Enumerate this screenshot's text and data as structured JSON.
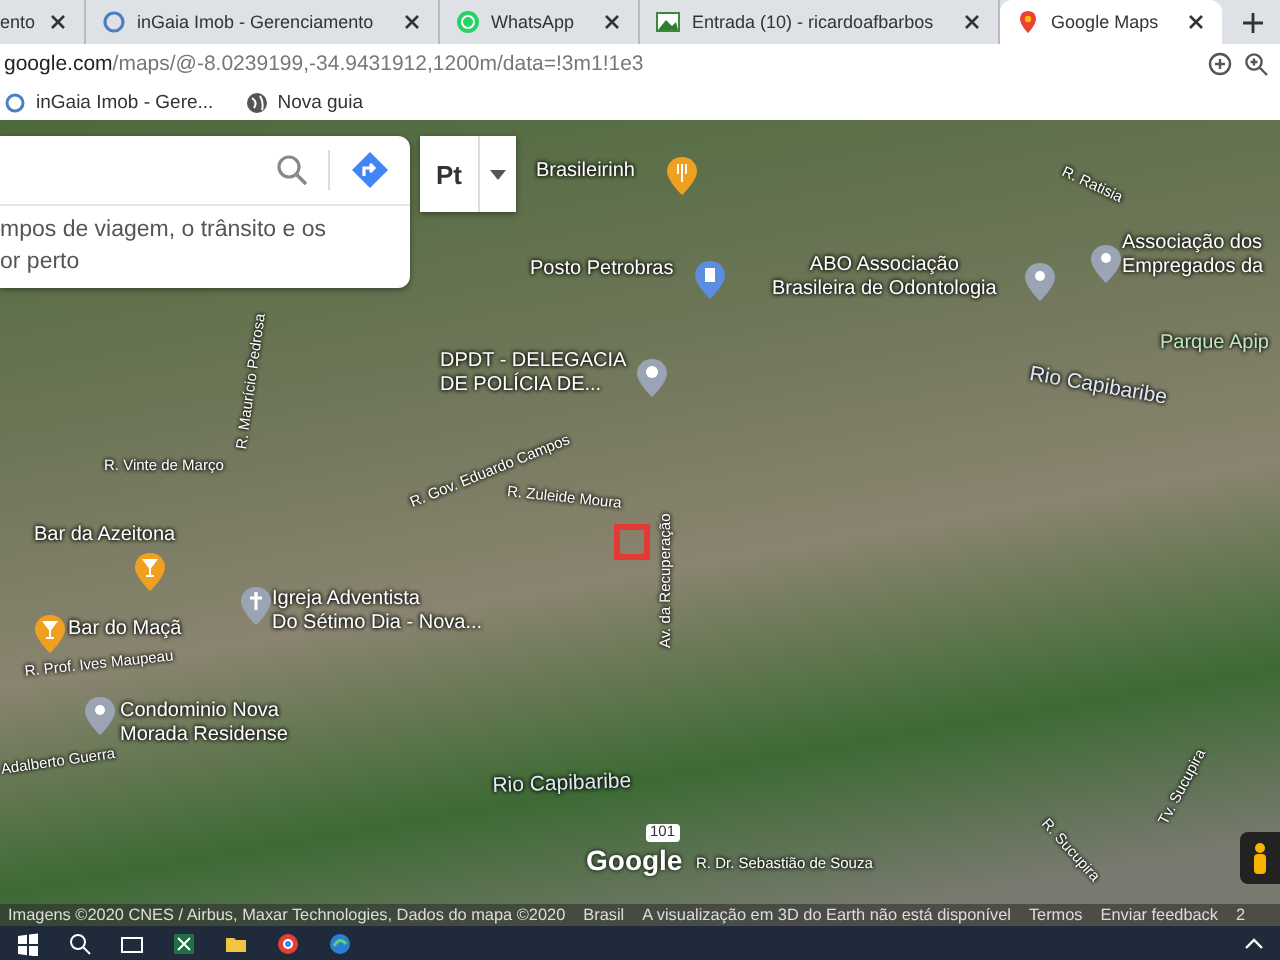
{
  "browser": {
    "tabs": [
      {
        "title": "ento",
        "selected": false
      },
      {
        "title": "inGaia Imob - Gerenciamento",
        "selected": false
      },
      {
        "title": "WhatsApp",
        "selected": false
      },
      {
        "title": "Entrada (10) - ricardoafbarbos",
        "selected": false
      },
      {
        "title": "Google Maps",
        "selected": true
      }
    ],
    "address": {
      "host": "google.com",
      "path": "/maps/@-8.0239199,-34.9431912,1200m/data=!3m1!1e3"
    },
    "bookmarks": [
      {
        "title": "inGaia Imob - Gere..."
      },
      {
        "title": "Nova guia"
      }
    ]
  },
  "map": {
    "search_box": {
      "hint_lines": [
        "mpos de viagem, o trânsito e os",
        "or perto"
      ]
    },
    "language_button": "Pt",
    "labels": [
      {
        "kind": "place",
        "lines": [
          "Brasileirinh"
        ]
      },
      {
        "kind": "place",
        "lines": [
          "Posto Petrobras"
        ]
      },
      {
        "kind": "place",
        "lines": [
          "ABO Associação",
          "Brasileira de Odontologia"
        ]
      },
      {
        "kind": "place",
        "lines": [
          "Associação dos",
          "Empregados da"
        ]
      },
      {
        "kind": "street",
        "lines": [
          "R. Ratisia"
        ]
      },
      {
        "kind": "place",
        "lines": [
          "DPDT - DELEGACIA",
          "DE POLÍCIA DE..."
        ]
      },
      {
        "kind": "park",
        "lines": [
          "Parque Apip"
        ]
      },
      {
        "kind": "water",
        "lines": [
          "Rio Capibaribe"
        ]
      },
      {
        "kind": "street",
        "lines": [
          "R. Maurício Pedrosa"
        ]
      },
      {
        "kind": "street",
        "lines": [
          "R. Gov. Eduardo Campos"
        ]
      },
      {
        "kind": "street",
        "lines": [
          "R. Vinte de Março"
        ]
      },
      {
        "kind": "street",
        "lines": [
          "R. Zuleide Moura"
        ]
      },
      {
        "kind": "street",
        "lines": [
          "Av. da Recuperação"
        ]
      },
      {
        "kind": "place",
        "lines": [
          "Bar da Azeitona"
        ]
      },
      {
        "kind": "place",
        "lines": [
          "Bar do Maçã"
        ]
      },
      {
        "kind": "place",
        "lines": [
          "Igreja Adventista",
          "Do Sétimo Dia - Nova..."
        ]
      },
      {
        "kind": "street",
        "lines": [
          "R. Prof. Ives Maupeau"
        ]
      },
      {
        "kind": "place",
        "lines": [
          "Condominio Nova",
          "Morada Residense"
        ]
      },
      {
        "kind": "street",
        "lines": [
          "Adalberto Guerra"
        ]
      },
      {
        "kind": "water",
        "lines": [
          "Rio Capibaribe"
        ]
      },
      {
        "kind": "shield",
        "lines": [
          "101"
        ]
      },
      {
        "kind": "street",
        "lines": [
          "R. Dr. Sebastião de Souza"
        ]
      },
      {
        "kind": "street",
        "lines": [
          "R. Sucupira"
        ]
      },
      {
        "kind": "street",
        "lines": [
          "Tv. Sucupira"
        ]
      }
    ],
    "logo": "Google",
    "attribution": [
      "Imagens ©2020 CNES / Airbus, Maxar Technologies, Dados do mapa ©2020",
      "Brasil",
      "A visualização em 3D do Earth não está disponível",
      "Termos",
      "Enviar feedback",
      "2"
    ]
  }
}
